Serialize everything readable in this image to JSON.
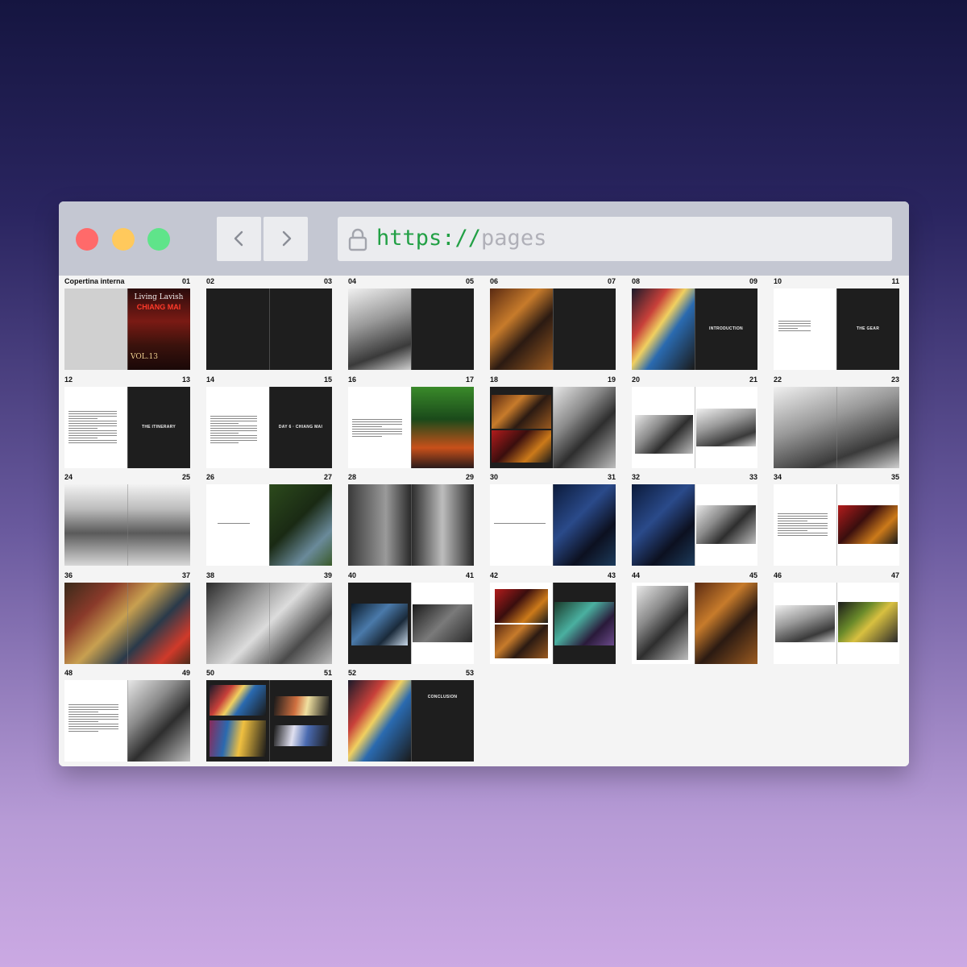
{
  "browser": {
    "url_scheme": "https://",
    "url_host": "pages",
    "back_icon": "chevron-left-icon",
    "forward_icon": "chevron-right-icon",
    "lock_icon": "lock-icon"
  },
  "spreads": [
    {
      "left": "Copertina interna",
      "right": "01",
      "cover_title": "Living Lavish",
      "cover_city": "CHIANG MAI",
      "cover_vol": "VOL.13"
    },
    {
      "left": "02",
      "right": "03"
    },
    {
      "left": "04",
      "right": "05"
    },
    {
      "left": "06",
      "right": "07"
    },
    {
      "left": "08",
      "right": "09",
      "title_right": "INTRODUCTION"
    },
    {
      "left": "10",
      "right": "11",
      "title_right": "THE GEAR"
    },
    {
      "left": "12",
      "right": "13",
      "title_right": "THE ITINERARY"
    },
    {
      "left": "14",
      "right": "15",
      "title_right": "DAY 6 · CHIANG MAI"
    },
    {
      "left": "16",
      "right": "17"
    },
    {
      "left": "18",
      "right": "19"
    },
    {
      "left": "20",
      "right": "21"
    },
    {
      "left": "22",
      "right": "23"
    },
    {
      "left": "24",
      "right": "25"
    },
    {
      "left": "26",
      "right": "27"
    },
    {
      "left": "28",
      "right": "29"
    },
    {
      "left": "30",
      "right": "31"
    },
    {
      "left": "32",
      "right": "33"
    },
    {
      "left": "34",
      "right": "35"
    },
    {
      "left": "36",
      "right": "37"
    },
    {
      "left": "38",
      "right": "39"
    },
    {
      "left": "40",
      "right": "41"
    },
    {
      "left": "42",
      "right": "43"
    },
    {
      "left": "44",
      "right": "45"
    },
    {
      "left": "46",
      "right": "47"
    },
    {
      "left": "48",
      "right": "49"
    },
    {
      "left": "50",
      "right": "51"
    },
    {
      "left": "52",
      "right": "53",
      "title_right": "CONCLUSION"
    }
  ],
  "colors": {
    "background_top": "#151540",
    "background_bottom": "#cba9e3",
    "url_scheme": "#22a045",
    "url_host": "#b0b0b8",
    "close_dot": "#ff6a6a",
    "minimize_dot": "#ffc95c",
    "maximize_dot": "#5fe48a"
  }
}
